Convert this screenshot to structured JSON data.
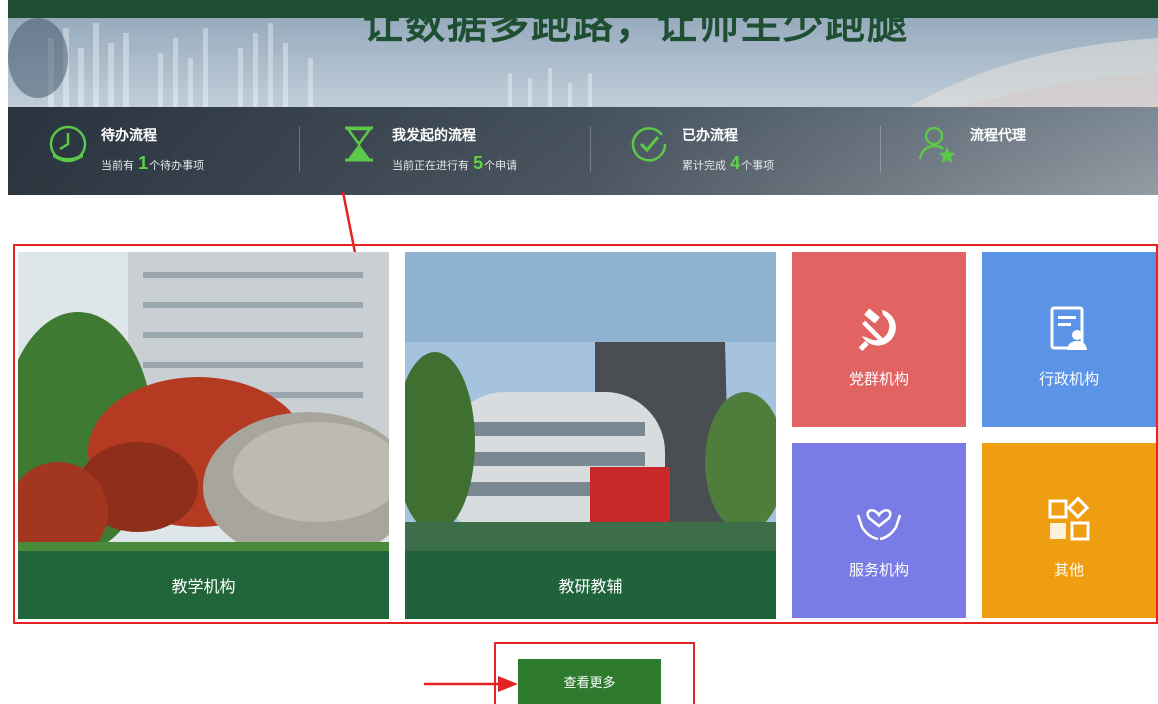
{
  "banner": {
    "slogan": "让数据多跑路，让师生少跑腿"
  },
  "workflows": [
    {
      "title": "待办流程",
      "prefix": "当前有",
      "count": "1",
      "suffix": "个待办事项",
      "icon": "clock-icon"
    },
    {
      "title": "我发起的流程",
      "prefix": "当前正在进行有",
      "count": "5",
      "suffix": "个申请",
      "icon": "hourglass-icon"
    },
    {
      "title": "已办流程",
      "prefix": "累计完成",
      "count": "4",
      "suffix": "个事项",
      "icon": "check-circle-icon"
    },
    {
      "title": "流程代理",
      "icon": "user-star-icon"
    }
  ],
  "tiles": {
    "teaching": {
      "label": "教学机构"
    },
    "research": {
      "label": "教研教辅"
    },
    "party": {
      "label": "党群机构",
      "color": "#e16463",
      "icon": "hammer-sickle-icon"
    },
    "admin": {
      "label": "行政机构",
      "color": "#5b94e6",
      "icon": "document-user-icon"
    },
    "service": {
      "label": "服务机构",
      "color": "#7a7ce5",
      "icon": "heart-hands-icon"
    },
    "other": {
      "label": "其他",
      "color": "#ee9e10",
      "icon": "shapes-icon"
    }
  },
  "more_button": {
    "label": "查看更多"
  },
  "colors": {
    "accent_green": "#2e7a2e",
    "highlight_red": "#e52323",
    "count_green": "#61d145"
  }
}
